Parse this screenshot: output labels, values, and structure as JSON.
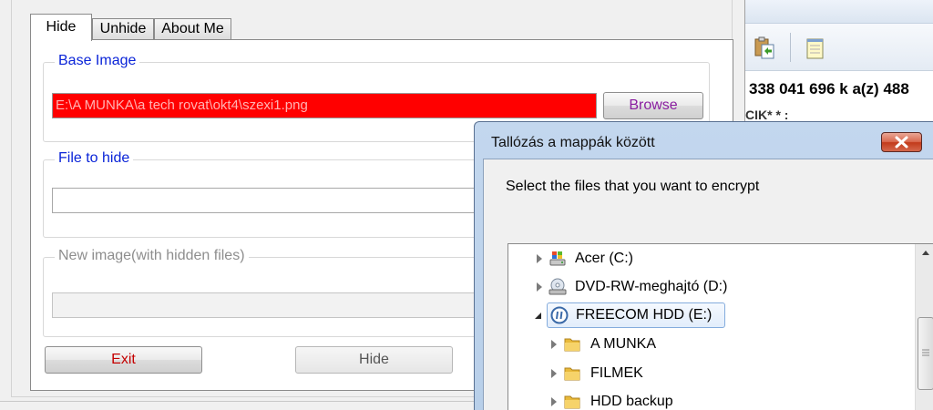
{
  "main_window": {
    "tabs": [
      {
        "label": "Hide",
        "active": true
      },
      {
        "label": "Unhide",
        "active": false
      },
      {
        "label": "About Me",
        "active": false
      }
    ],
    "base_image": {
      "group_label": "Base Image",
      "path_value": "E:\\A MUNKA\\a tech rovat\\okt4\\szexi1.png",
      "browse_label": "Browse"
    },
    "file_to_hide": {
      "group_label": "File to hide",
      "value": ""
    },
    "new_image": {
      "group_label": "New image(with hidden files)",
      "value": ""
    },
    "buttons": {
      "exit_label": "Exit",
      "hide_label": "Hide"
    },
    "colors": {
      "group_label_blue": "#0a24d8",
      "path_field_bg": "#ff0000",
      "browse_text": "#8a1ea0",
      "exit_text": "#c40000"
    }
  },
  "background_window": {
    "amount_text": "338 041 696 k a(z) 488",
    "partial_text": "CIK* * :"
  },
  "browse_dialog": {
    "title": "Tallózás a mappák között",
    "instruction": "Select the files that you want to encrypt",
    "tree": [
      {
        "label": "Acer (C:)",
        "icon": "hard-drive-icon",
        "state": "collapsed",
        "level": 0
      },
      {
        "label": "DVD-RW-meghajtó (D:)",
        "icon": "dvd-drive-icon",
        "state": "collapsed",
        "level": 0
      },
      {
        "label": "FREECOM HDD (E:)",
        "icon": "external-drive-icon",
        "state": "expanded",
        "level": 0,
        "selected": true
      },
      {
        "label": "A MUNKA",
        "icon": "folder-icon",
        "state": "collapsed",
        "level": 1
      },
      {
        "label": "FILMEK",
        "icon": "folder-icon",
        "state": "collapsed",
        "level": 1
      },
      {
        "label": "HDD backup",
        "icon": "folder-icon",
        "state": "collapsed",
        "level": 1
      }
    ]
  }
}
